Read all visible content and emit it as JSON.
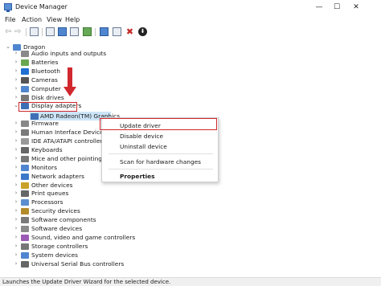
{
  "window": {
    "title": "Device Manager",
    "minimize_glyph": "—",
    "maximize_glyph": "☐",
    "close_glyph": "✕"
  },
  "menubar": [
    "File",
    "Action",
    "View",
    "Help"
  ],
  "toolbar": {
    "icons": [
      "back-arrow-icon",
      "forward-arrow-icon",
      "properties-icon",
      "show-hidden-icon",
      "help-icon",
      "update-driver-icon",
      "scan-hardware-icon",
      "add-legacy-icon",
      "uninstall-icon",
      "download-icon"
    ],
    "back_glyph": "⇦",
    "forward_glyph": "⇨",
    "uninstall_glyph": "✖",
    "download_glyph": "⬇"
  },
  "tree": {
    "root": "Dragon",
    "categories": [
      "Audio inputs and outputs",
      "Batteries",
      "Bluetooth",
      "Cameras",
      "Computer",
      "Disk drives",
      "Display adapters",
      "Firmware",
      "Human Interface Devices",
      "IDE ATA/ATAPI controllers",
      "Keyboards",
      "Mice and other pointing devices",
      "Monitors",
      "Network adapters",
      "Other devices",
      "Print queues",
      "Processors",
      "Security devices",
      "Software components",
      "Software devices",
      "Sound, video and game controllers",
      "Storage controllers",
      "System devices",
      "Universal Serial Bus controllers"
    ],
    "expanded_child": "AMD Radeon(TM) Graphics",
    "expand_glyph": "›",
    "collapse_glyph": "⌄"
  },
  "context_menu": {
    "update_driver": "Update driver",
    "disable_device": "Disable device",
    "uninstall_device": "Uninstall device",
    "scan": "Scan for hardware changes",
    "properties": "Properties"
  },
  "status_bar": "Launches the Update Driver Wizard for the selected device.",
  "colors": {
    "annotation_red": "#d0282e",
    "selection_blue": "#cce4f7"
  }
}
